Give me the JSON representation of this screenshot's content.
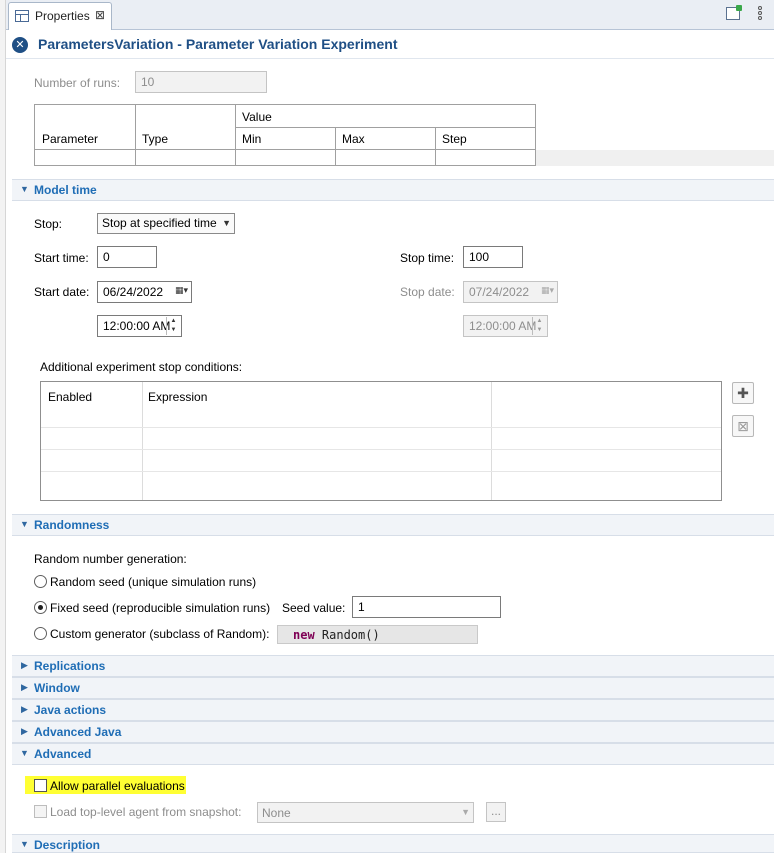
{
  "tab": {
    "label": "Properties"
  },
  "header": {
    "title": "ParametersVariation - Parameter Variation Experiment"
  },
  "runs": {
    "label": "Number of runs:",
    "value": "10"
  },
  "params_table": {
    "value_group": "Value",
    "columns": [
      "Parameter",
      "Type",
      "Min",
      "Max",
      "Step"
    ]
  },
  "model_time": {
    "section": "Model time",
    "stop_label": "Stop:",
    "stop_value": "Stop at specified time",
    "start_time_label": "Start time:",
    "start_time_value": "0",
    "stop_time_label": "Stop time:",
    "stop_time_value": "100",
    "start_date_label": "Start date:",
    "start_date_value": "06/24/2022",
    "start_clock_value": "12:00:00 AM",
    "stop_date_label": "Stop date:",
    "stop_date_value": "07/24/2022",
    "stop_clock_value": "12:00:00 AM",
    "conditions_label": "Additional experiment stop conditions:",
    "conditions_columns": [
      "Enabled",
      "Expression"
    ]
  },
  "randomness": {
    "section": "Randomness",
    "rng_label": "Random number generation:",
    "options": [
      "Random seed (unique simulation runs)",
      "Fixed seed (reproducible simulation runs)",
      "Custom generator (subclass of Random):"
    ],
    "selected": 1,
    "seed_label": "Seed value:",
    "seed_value": "1",
    "custom_keyword": "new",
    "custom_code": " Random()"
  },
  "collapsed_sections": [
    "Replications",
    "Window",
    "Java actions",
    "Advanced Java"
  ],
  "advanced": {
    "section": "Advanced",
    "parallel_label": "Allow parallel evaluations",
    "snapshot_label": "Load top-level agent from snapshot:",
    "snapshot_value": "None",
    "browse_label": "..."
  },
  "description": {
    "section": "Description"
  },
  "colors": {
    "title": "#1f4f85",
    "section_title": "#1f6db5",
    "highlight": "#ffff33",
    "keyword": "#7f0055"
  }
}
